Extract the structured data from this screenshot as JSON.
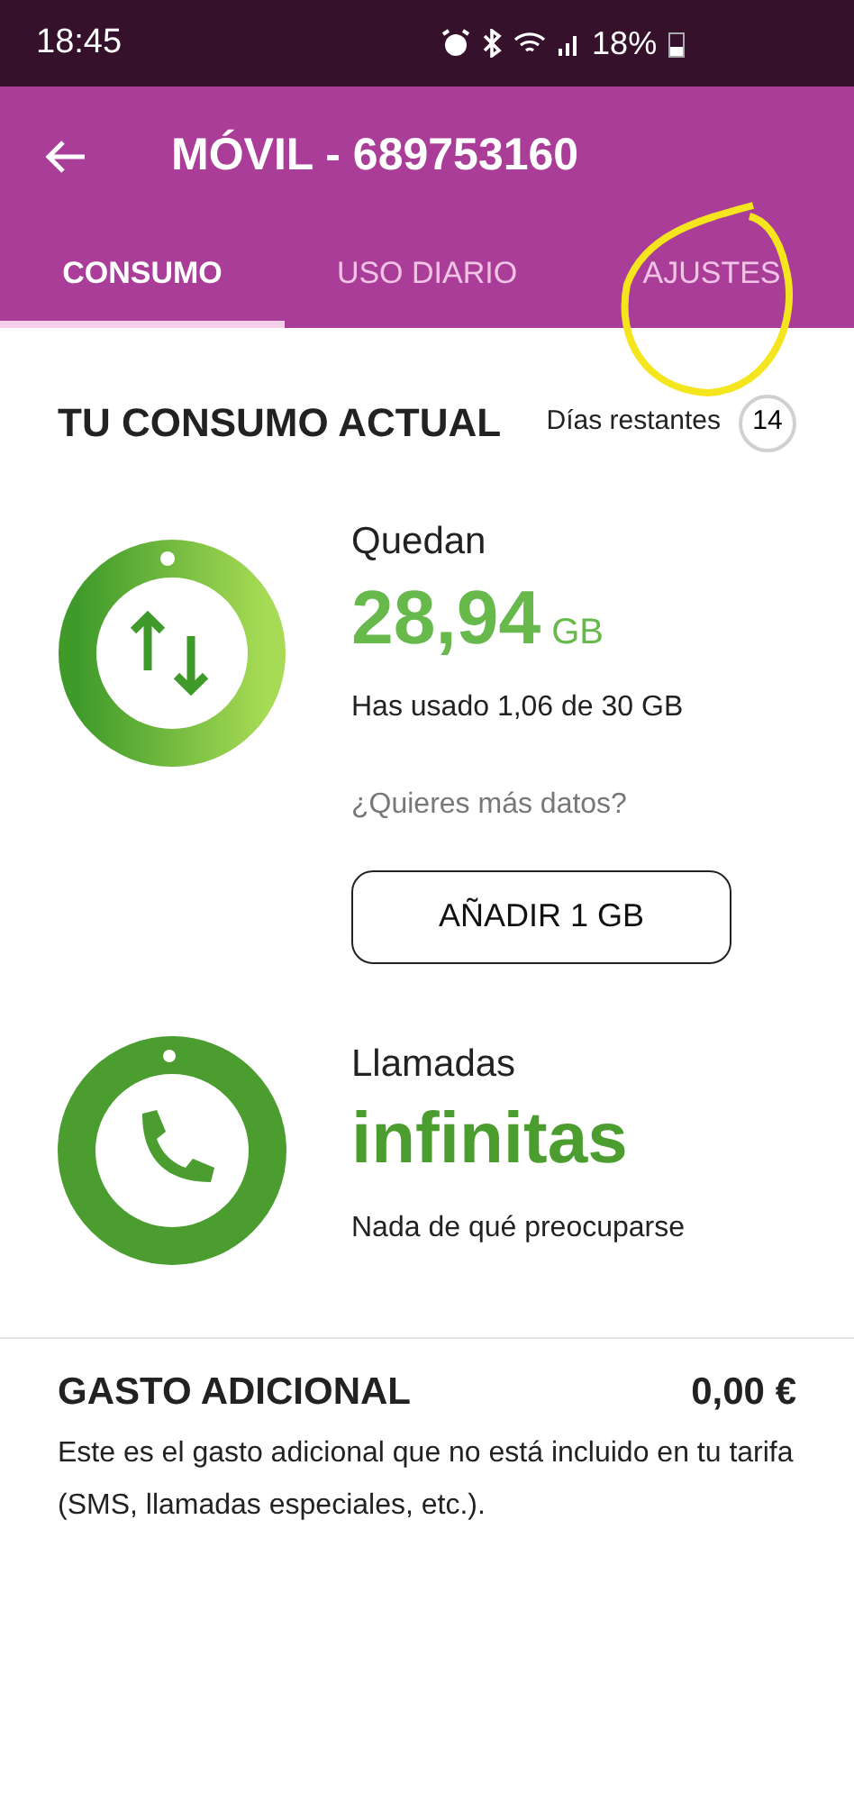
{
  "status_bar": {
    "time": "18:45",
    "battery": "18%"
  },
  "header": {
    "title": "MÓVIL - 689753160"
  },
  "tabs": [
    {
      "label": "CONSUMO",
      "selected": true
    },
    {
      "label": "USO DIARIO",
      "selected": false
    },
    {
      "label": "AJUSTES",
      "selected": false
    }
  ],
  "consumo": {
    "title": "TU CONSUMO ACTUAL",
    "days_label": "Días restantes",
    "days_value": "14"
  },
  "data": {
    "label": "Quedan",
    "amount": "28,94",
    "unit": "GB",
    "used": "Has usado 1,06 de 30 GB",
    "more_prompt": "¿Quieres más datos?",
    "button": "AÑADIR 1 GB"
  },
  "calls": {
    "label": "Llamadas",
    "amount": "infinitas",
    "note": "Nada de qué preocuparse"
  },
  "extra": {
    "title": "GASTO ADICIONAL",
    "amount": "0,00 €",
    "description": "Este es el gasto adicional que no está incluido en tu tarifa (SMS, llamadas especiales, etc.)."
  }
}
